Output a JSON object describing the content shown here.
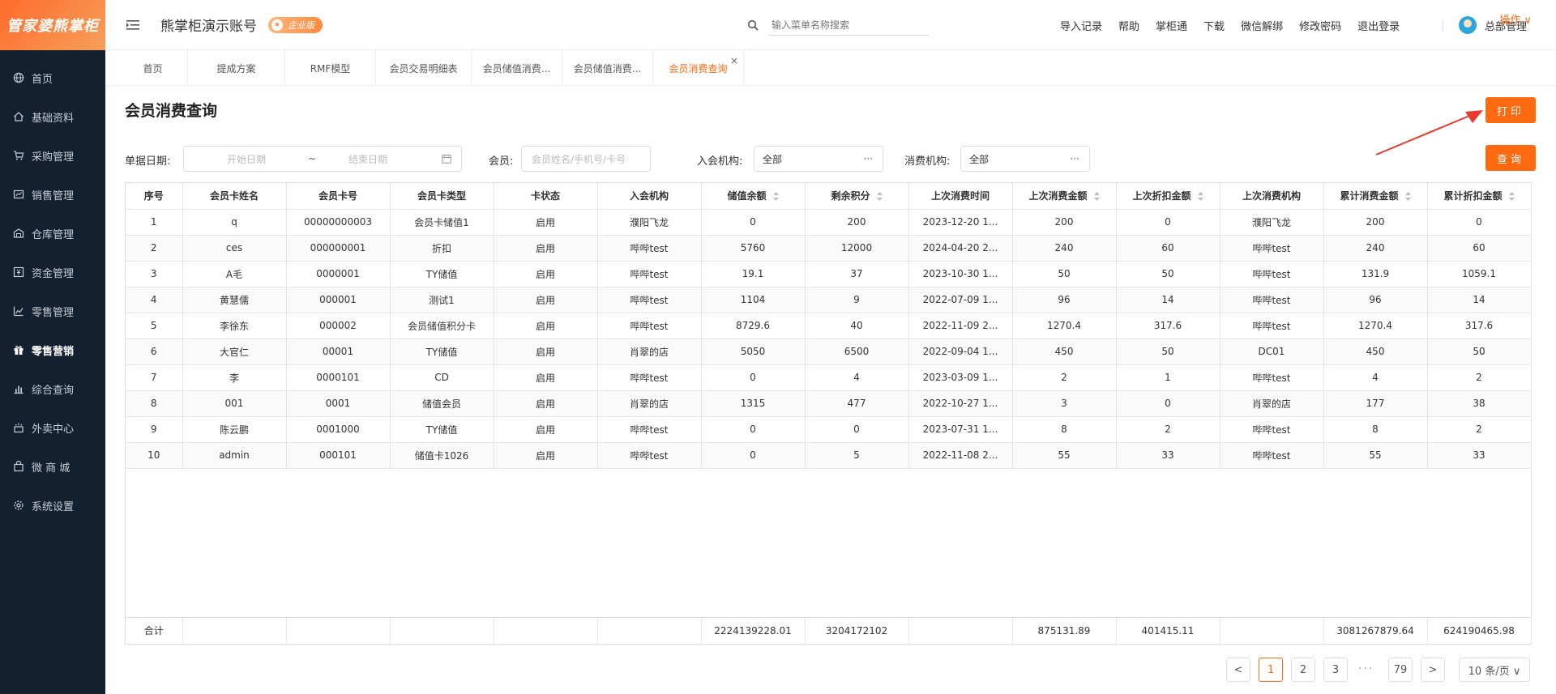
{
  "brand": {
    "logo_text": "管家婆熊掌柜"
  },
  "sidebar": {
    "items": [
      {
        "label": "首页",
        "icon": "globe-icon"
      },
      {
        "label": "基础资料",
        "icon": "home-icon"
      },
      {
        "label": "采购管理",
        "icon": "cart-icon"
      },
      {
        "label": "销售管理",
        "icon": "sales-icon"
      },
      {
        "label": "仓库管理",
        "icon": "warehouse-icon"
      },
      {
        "label": "资金管理",
        "icon": "money-icon"
      },
      {
        "label": "零售管理",
        "icon": "chart-icon"
      },
      {
        "label": "零售营销",
        "icon": "gift-icon"
      },
      {
        "label": "综合查询",
        "icon": "bar-chart-icon"
      },
      {
        "label": "外卖中心",
        "icon": "delivery-icon"
      },
      {
        "label": "微 商 城",
        "icon": "bag-icon"
      },
      {
        "label": "系统设置",
        "icon": "gear-icon"
      }
    ],
    "active_index": 7
  },
  "header": {
    "title": "熊掌柜演示账号",
    "edition": "企业版",
    "search_placeholder": "输入菜单名称搜索",
    "links": [
      "导入记录",
      "帮助",
      "掌柜通",
      "下载",
      "微信解绑",
      "修改密码",
      "退出登录"
    ],
    "user": "总部管理"
  },
  "tabs": {
    "items": [
      "首页",
      "提成方案",
      "RMF模型",
      "会员交易明细表",
      "会员储值消费...",
      "会员储值消费...",
      "会员消费查询"
    ],
    "active_index": 6,
    "close_glyph": "×",
    "ops_label": "操作 ∨"
  },
  "page": {
    "title": "会员消费查询",
    "print_label": "打印",
    "query_label": "查询"
  },
  "filters": {
    "date_label": "单据日期:",
    "start_placeholder": "开始日期",
    "tilde": "~",
    "end_placeholder": "结束日期",
    "member_label": "会员:",
    "member_placeholder": "会员姓名/手机号/卡号",
    "join_org_label": "入会机构:",
    "join_org_value": "全部",
    "consume_org_label": "消费机构:",
    "consume_org_value": "全部",
    "more_glyph": "···"
  },
  "table": {
    "columns": [
      {
        "label": "序号",
        "sortable": false
      },
      {
        "label": "会员卡姓名",
        "sortable": false
      },
      {
        "label": "会员卡号",
        "sortable": false
      },
      {
        "label": "会员卡类型",
        "sortable": false
      },
      {
        "label": "卡状态",
        "sortable": false
      },
      {
        "label": "入会机构",
        "sortable": false
      },
      {
        "label": "储值余额",
        "sortable": true
      },
      {
        "label": "剩余积分",
        "sortable": true
      },
      {
        "label": "上次消费时间",
        "sortable": false
      },
      {
        "label": "上次消费金额",
        "sortable": true
      },
      {
        "label": "上次折扣金额",
        "sortable": true
      },
      {
        "label": "上次消费机构",
        "sortable": false
      },
      {
        "label": "累计消费金额",
        "sortable": true
      },
      {
        "label": "累计折扣金额",
        "sortable": true
      }
    ],
    "rows": [
      [
        "1",
        "q",
        "00000000003",
        "会员卡储值1",
        "启用",
        "濮阳飞龙",
        "0",
        "200",
        "2023-12-20 1...",
        "200",
        "0",
        "濮阳飞龙",
        "200",
        "0"
      ],
      [
        "2",
        "ces",
        "000000001",
        "折扣",
        "启用",
        "哔哔test",
        "5760",
        "12000",
        "2024-04-20 2...",
        "240",
        "60",
        "哔哔test",
        "240",
        "60"
      ],
      [
        "3",
        "A毛",
        "0000001",
        "TY储值",
        "启用",
        "哔哔test",
        "19.1",
        "37",
        "2023-10-30 1...",
        "50",
        "50",
        "哔哔test",
        "131.9",
        "1059.1"
      ],
      [
        "4",
        "黄慧儒",
        "000001",
        "测试1",
        "启用",
        "哔哔test",
        "1104",
        "9",
        "2022-07-09 1...",
        "96",
        "14",
        "哔哔test",
        "96",
        "14"
      ],
      [
        "5",
        "李徐东",
        "000002",
        "会员储值积分卡",
        "启用",
        "哔哔test",
        "8729.6",
        "40",
        "2022-11-09 2...",
        "1270.4",
        "317.6",
        "哔哔test",
        "1270.4",
        "317.6"
      ],
      [
        "6",
        "大官仁",
        "00001",
        "TY储值",
        "启用",
        "肖翠的店",
        "5050",
        "6500",
        "2022-09-04 1...",
        "450",
        "50",
        "DC01",
        "450",
        "50"
      ],
      [
        "7",
        "李",
        "0000101",
        "CD",
        "启用",
        "哔哔test",
        "0",
        "4",
        "2023-03-09 1...",
        "2",
        "1",
        "哔哔test",
        "4",
        "2"
      ],
      [
        "8",
        "001",
        "0001",
        "储值会员",
        "启用",
        "肖翠的店",
        "1315",
        "477",
        "2022-10-27 1...",
        "3",
        "0",
        "肖翠的店",
        "177",
        "38"
      ],
      [
        "9",
        "陈云鹏",
        "0001000",
        "TY储值",
        "启用",
        "哔哔test",
        "0",
        "0",
        "2023-07-31 1...",
        "8",
        "2",
        "哔哔test",
        "8",
        "2"
      ],
      [
        "10",
        "admin",
        "000101",
        "储值卡1026",
        "启用",
        "哔哔test",
        "0",
        "5",
        "2022-11-08 2...",
        "55",
        "33",
        "哔哔test",
        "55",
        "33"
      ]
    ],
    "totals": [
      "合计",
      "",
      "",
      "",
      "",
      "",
      "2224139228.01",
      "3204172102",
      "",
      "875131.89",
      "401415.11",
      "",
      "3081267879.64",
      "624190465.98"
    ]
  },
  "pagination": {
    "prev": "<",
    "pages": [
      "1",
      "2",
      "3"
    ],
    "dots": "···",
    "last": "79",
    "next": ">",
    "page_size": "10 条/页 ∨",
    "current_page": 1
  },
  "colors": {
    "accent": "#ff6a10",
    "sidebar_bg": "#13202f",
    "arrow": "#e83a2f"
  }
}
